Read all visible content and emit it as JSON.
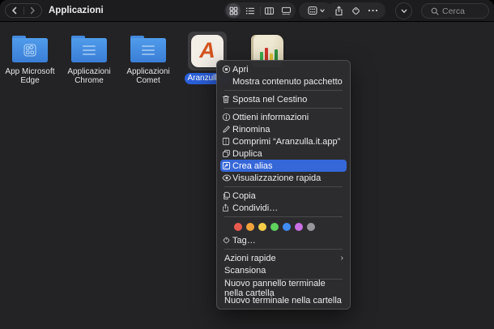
{
  "toolbar": {
    "title": "Applicazioni",
    "search_placeholder": "Cerca",
    "more_label": "•••"
  },
  "files": [
    {
      "name": "App Microsoft Edge",
      "icon": "folder-apps-icon"
    },
    {
      "name": "Applicazioni Chrome",
      "icon": "folder-list-icon"
    },
    {
      "name": "Applicazioni Comet",
      "icon": "folder-list-icon"
    },
    {
      "name": "Aranzulla...",
      "icon": "aranzulla-app-icon",
      "selected": true
    },
    {
      "name": "",
      "icon": "book-app-icon"
    }
  ],
  "menu": {
    "highlight_color": "#3567d8",
    "items": [
      {
        "label": "Apri",
        "icon": "open-icon"
      },
      {
        "label": "Mostra contenuto pacchetto"
      },
      {
        "label": "Sposta nel Cestino",
        "icon": "trash-icon"
      },
      {
        "label": "Ottieni informazioni",
        "icon": "info-icon"
      },
      {
        "label": "Rinomina",
        "icon": "pencil-icon"
      },
      {
        "label": "Comprimi “Aranzulla.it.app”",
        "icon": "compress-icon"
      },
      {
        "label": "Duplica",
        "icon": "duplicate-icon"
      },
      {
        "label": "Crea alias",
        "icon": "alias-icon",
        "highlighted": true
      },
      {
        "label": "Visualizzazione rapida",
        "icon": "eye-icon"
      },
      {
        "label": "Copia",
        "icon": "copy-icon"
      },
      {
        "label": "Condividi…",
        "icon": "share-icon"
      },
      {
        "label": "Tag…",
        "icon": "tag-icon"
      },
      {
        "label": "Azioni rapide",
        "submenu": "›"
      },
      {
        "label": "Scansiona"
      },
      {
        "label": "Nuovo pannello terminale nella cartella"
      },
      {
        "label": "Nuovo terminale nella cartella"
      }
    ],
    "submenu_arrow": "›",
    "tag_colors": [
      "#e95a4e",
      "#f2a33c",
      "#f6cf47",
      "#5fd15f",
      "#418cf6",
      "#c96fe3",
      "#96969b"
    ]
  },
  "colors": {
    "selection_blue": "#2a5fd9",
    "folder_blue": "#4489dd",
    "window_bg": "#232325",
    "toolbar_bg": "#1c1c1e",
    "menu_bg": "#2d2d30"
  },
  "aranzulla_logo_letter": "A"
}
